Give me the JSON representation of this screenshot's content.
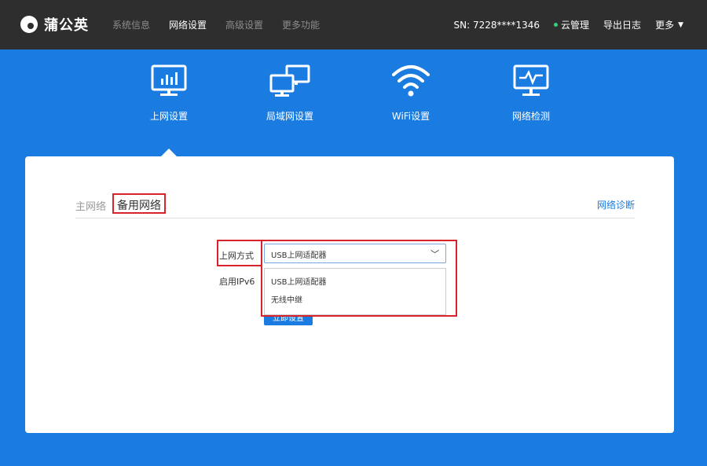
{
  "brand": {
    "name": "蒲公英"
  },
  "nav": {
    "items": [
      "系统信息",
      "网络设置",
      "高级设置",
      "更多功能"
    ],
    "active_index": 1
  },
  "header_right": {
    "sn": "SN:  7228****1346",
    "cloud": "云管理",
    "export_log": "导出日志",
    "more": "更多"
  },
  "sections": [
    {
      "label": "上网设置",
      "icon": "monitor-chart-icon"
    },
    {
      "label": "局域网设置",
      "icon": "lan-monitors-icon"
    },
    {
      "label": "WiFi设置",
      "icon": "wifi-icon"
    },
    {
      "label": "网络检测",
      "icon": "monitor-pulse-icon"
    }
  ],
  "tabs": {
    "main": "主网络",
    "backup": "备用网络",
    "diagnose": "网络诊断"
  },
  "form": {
    "conn_label": "上网方式",
    "ipv6_label": "启用IPv6",
    "select_value": "USB上网适配器",
    "options": [
      "USB上网适配器",
      "无线中继"
    ],
    "apply": "立即设置"
  },
  "colors": {
    "header_bg": "#2e2e2e",
    "accent": "#1a7be0",
    "highlight": "#d9232b",
    "cloud_dot": "#2ed573"
  }
}
